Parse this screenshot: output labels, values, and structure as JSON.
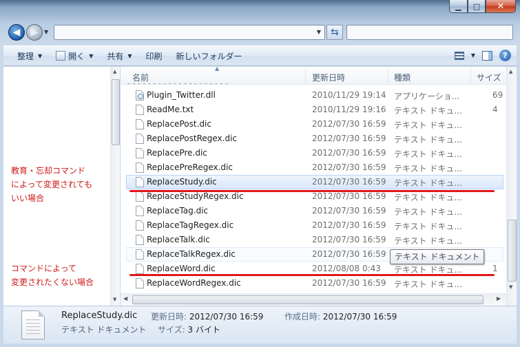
{
  "window": {
    "caption": {
      "minimize": "▁",
      "maximize": "□",
      "close": "✕"
    }
  },
  "address": {
    "path": "",
    "search_placeholder": ""
  },
  "toolbar": {
    "organize": "整理",
    "open": "開く",
    "share": "共有",
    "print": "印刷",
    "new_folder": "新しいフォルダー",
    "help": "?"
  },
  "columns": {
    "name": "名前",
    "date": "更新日時",
    "type": "種類",
    "size": "サイズ"
  },
  "files": [
    {
      "name": "Plugin_Twitter.dll",
      "date": "2010/11/29 19:14",
      "type": "アプリケーショ...",
      "size": "69",
      "icon": "dll-icon",
      "state": "normal"
    },
    {
      "name": "ReadMe.txt",
      "date": "2010/11/29 19:16",
      "type": "テキスト ドキュ...",
      "size": "4",
      "icon": "text-file-icon",
      "state": "normal"
    },
    {
      "name": "ReplacePost.dic",
      "date": "2012/07/30 16:59",
      "type": "テキスト ドキュ...",
      "size": "",
      "icon": "text-file-icon",
      "state": "normal"
    },
    {
      "name": "ReplacePostRegex.dic",
      "date": "2012/07/30 16:59",
      "type": "テキスト ドキュ...",
      "size": "",
      "icon": "text-file-icon",
      "state": "normal"
    },
    {
      "name": "ReplacePre.dic",
      "date": "2012/07/30 16:59",
      "type": "テキスト ドキュ...",
      "size": "",
      "icon": "text-file-icon",
      "state": "normal"
    },
    {
      "name": "ReplacePreRegex.dic",
      "date": "2012/07/30 16:59",
      "type": "テキスト ドキュ...",
      "size": "",
      "icon": "text-file-icon",
      "state": "normal"
    },
    {
      "name": "ReplaceStudy.dic",
      "date": "2012/07/30 16:59",
      "type": "テキスト ドキュ...",
      "size": "",
      "icon": "text-file-icon",
      "state": "selected"
    },
    {
      "name": "ReplaceStudyRegex.dic",
      "date": "2012/07/30 16:59",
      "type": "テキスト ドキュ...",
      "size": "",
      "icon": "text-file-icon",
      "state": "normal"
    },
    {
      "name": "ReplaceTag.dic",
      "date": "2012/07/30 16:59",
      "type": "テキスト ドキュ...",
      "size": "",
      "icon": "text-file-icon",
      "state": "normal"
    },
    {
      "name": "ReplaceTagRegex.dic",
      "date": "2012/07/30 16:59",
      "type": "テキスト ドキュ...",
      "size": "",
      "icon": "text-file-icon",
      "state": "normal"
    },
    {
      "name": "ReplaceTalk.dic",
      "date": "2012/07/30 16:59",
      "type": "テキスト ドキュ...",
      "size": "",
      "icon": "text-file-icon",
      "state": "normal"
    },
    {
      "name": "ReplaceTalkRegex.dic",
      "date": "2012/07/30 16:59",
      "type": "テキスト ドキュ...",
      "size": "",
      "icon": "text-file-icon",
      "state": "hover"
    },
    {
      "name": "ReplaceWord.dic",
      "date": "2012/08/08 0:43",
      "type": "テキスト ドキュ...",
      "size": "1",
      "icon": "text-file-icon",
      "state": "normal"
    },
    {
      "name": "ReplaceWordRegex.dic",
      "date": "2012/07/30 16:59",
      "type": "テキスト ドキュ...",
      "size": "",
      "icon": "text-file-icon",
      "state": "normal"
    }
  ],
  "tooltip": "テキスト ドキュメント",
  "annotations": {
    "note1": [
      "教育・忘却コマンド",
      "によって変更されても",
      "いい場合"
    ],
    "note2": [
      "コマンドによって",
      "変更されたくない場合"
    ],
    "color": "#e01818"
  },
  "details": {
    "name": "ReplaceStudy.dic",
    "type": "テキスト ドキュメント",
    "modified_label": "更新日時:",
    "modified_value": "2012/07/30 16:59",
    "created_label": "作成日時:",
    "created_value": "2012/07/30 16:59",
    "size_label": "サイズ:",
    "size_value": "3 バイト"
  }
}
